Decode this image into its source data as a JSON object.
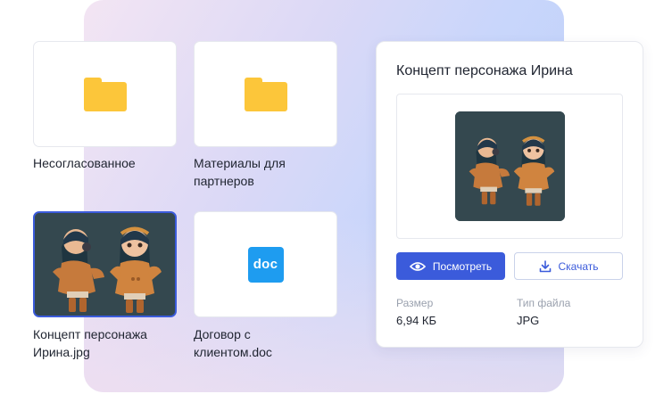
{
  "files": [
    {
      "name": "Несогласованное",
      "icon": "folder-icon"
    },
    {
      "name": "Материалы для партнеров",
      "icon": "folder-icon"
    },
    {
      "name": "Концепт персонажа Ирина.jpg",
      "icon": "image-thumbnail",
      "selected": true
    },
    {
      "name": "Договор с клиентом.doc",
      "icon": "doc-icon",
      "badge": "doc"
    }
  ],
  "details": {
    "title": "Концепт персонажа Ирина",
    "view_label": "Посмотреть",
    "download_label": "Скачать",
    "size_label": "Размер",
    "size_value": "6,94 КБ",
    "type_label": "Тип файла",
    "type_value": "JPG"
  },
  "colors": {
    "accent": "#3b5bdb",
    "folder": "#fcc63a",
    "doc_badge": "#1e9cf0"
  }
}
